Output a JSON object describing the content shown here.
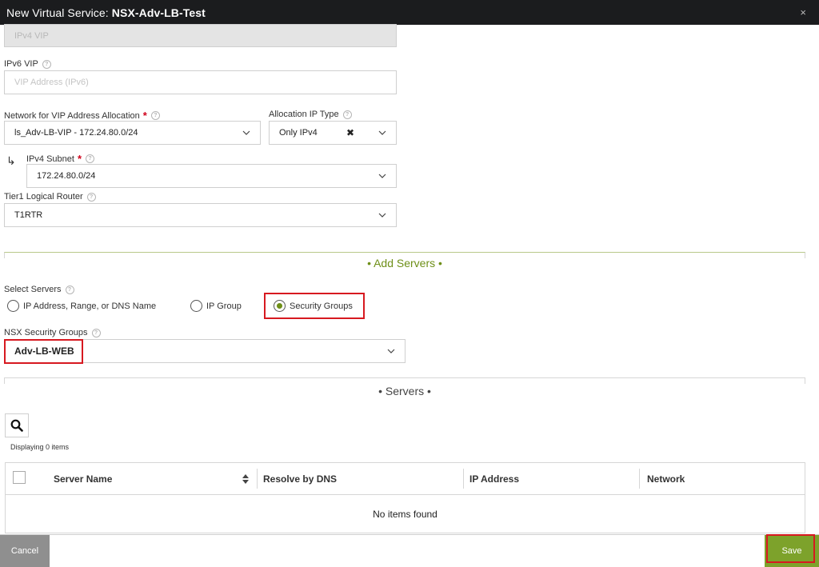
{
  "dialog": {
    "title_prefix": "New Virtual Service:",
    "title_name": "NSX-Adv-LB-Test",
    "close_glyph": "×"
  },
  "ipv4_vip": {
    "placeholder": "IPv4 VIP"
  },
  "ipv6_vip": {
    "label": "IPv6 VIP",
    "placeholder": "VIP Address (IPv6)"
  },
  "network": {
    "label": "Network for VIP Address Allocation",
    "value": "ls_Adv-LB-VIP - 172.24.80.0/24"
  },
  "allocation_ip_type": {
    "label": "Allocation IP Type",
    "value": "Only IPv4",
    "clear_glyph": "✖"
  },
  "ipv4_subnet": {
    "label": "IPv4 Subnet",
    "value": "172.24.80.0/24",
    "arrow_glyph": "↳"
  },
  "tier1_router": {
    "label": "Tier1 Logical Router",
    "value": "T1RTR"
  },
  "add_servers": {
    "title": "• Add Servers •"
  },
  "select_servers": {
    "label": "Select Servers",
    "options": [
      "IP Address, Range, or DNS Name",
      "IP Group",
      "Security Groups"
    ],
    "selected": "Security Groups"
  },
  "nsx_security_groups": {
    "label": "NSX Security Groups",
    "value": "Adv-LB-WEB"
  },
  "servers": {
    "title": "• Servers •",
    "displaying": "Displaying 0 items",
    "columns": [
      "Server Name",
      "Resolve by DNS",
      "IP Address",
      "Network"
    ],
    "empty_text": "No items found"
  },
  "footer": {
    "cancel_label": "Cancel",
    "save_label": "Save"
  },
  "colors": {
    "accent": "#7da22b",
    "highlight": "#d71920",
    "titlebar": "#1b1c1e"
  }
}
